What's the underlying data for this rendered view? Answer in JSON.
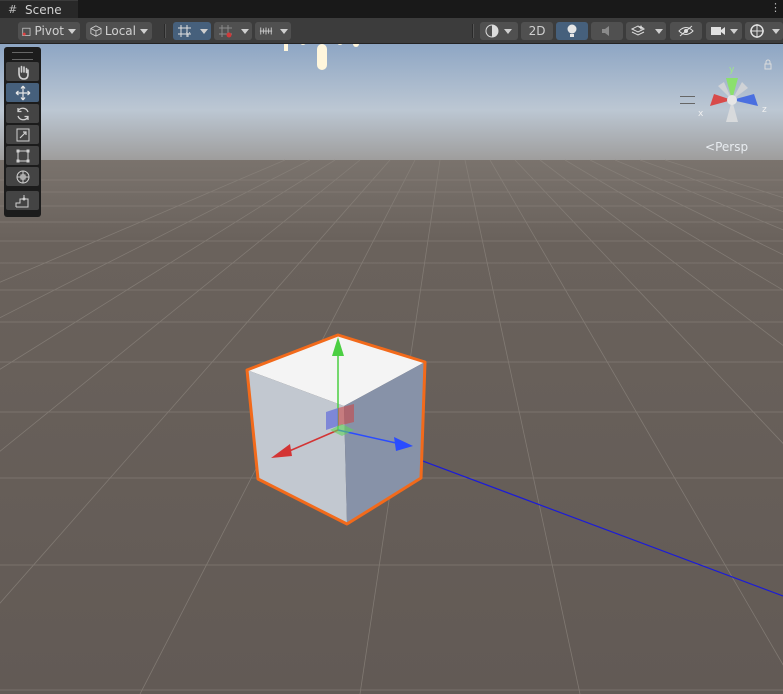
{
  "tab": {
    "label": "Scene",
    "icon": "grid-icon",
    "more": "⋮"
  },
  "toolbar": {
    "pivot_label": "Pivot",
    "local_label": "Local",
    "mode_2d_label": "2D"
  },
  "tools": [
    {
      "name": "hand-tool",
      "icon": "hand-icon"
    },
    {
      "name": "move-tool",
      "icon": "move-icon"
    },
    {
      "name": "rotate-tool",
      "icon": "rotate-icon"
    },
    {
      "name": "scale-tool",
      "icon": "scale-icon"
    },
    {
      "name": "rect-tool",
      "icon": "rect-icon"
    },
    {
      "name": "transform-tool",
      "icon": "transform-icon"
    },
    {
      "name": "custom-tool",
      "icon": "custom-tool-icon"
    }
  ],
  "gizmo": {
    "y": "y",
    "x": "x",
    "z": "z",
    "projection_label": "Persp"
  },
  "colors": {
    "selection_outline": "#f26a1b",
    "axis_x": "#d33434",
    "axis_y": "#4bcf42",
    "axis_z": "#2a4cff",
    "ground": "#67605a",
    "sky": "#aabbd2"
  }
}
